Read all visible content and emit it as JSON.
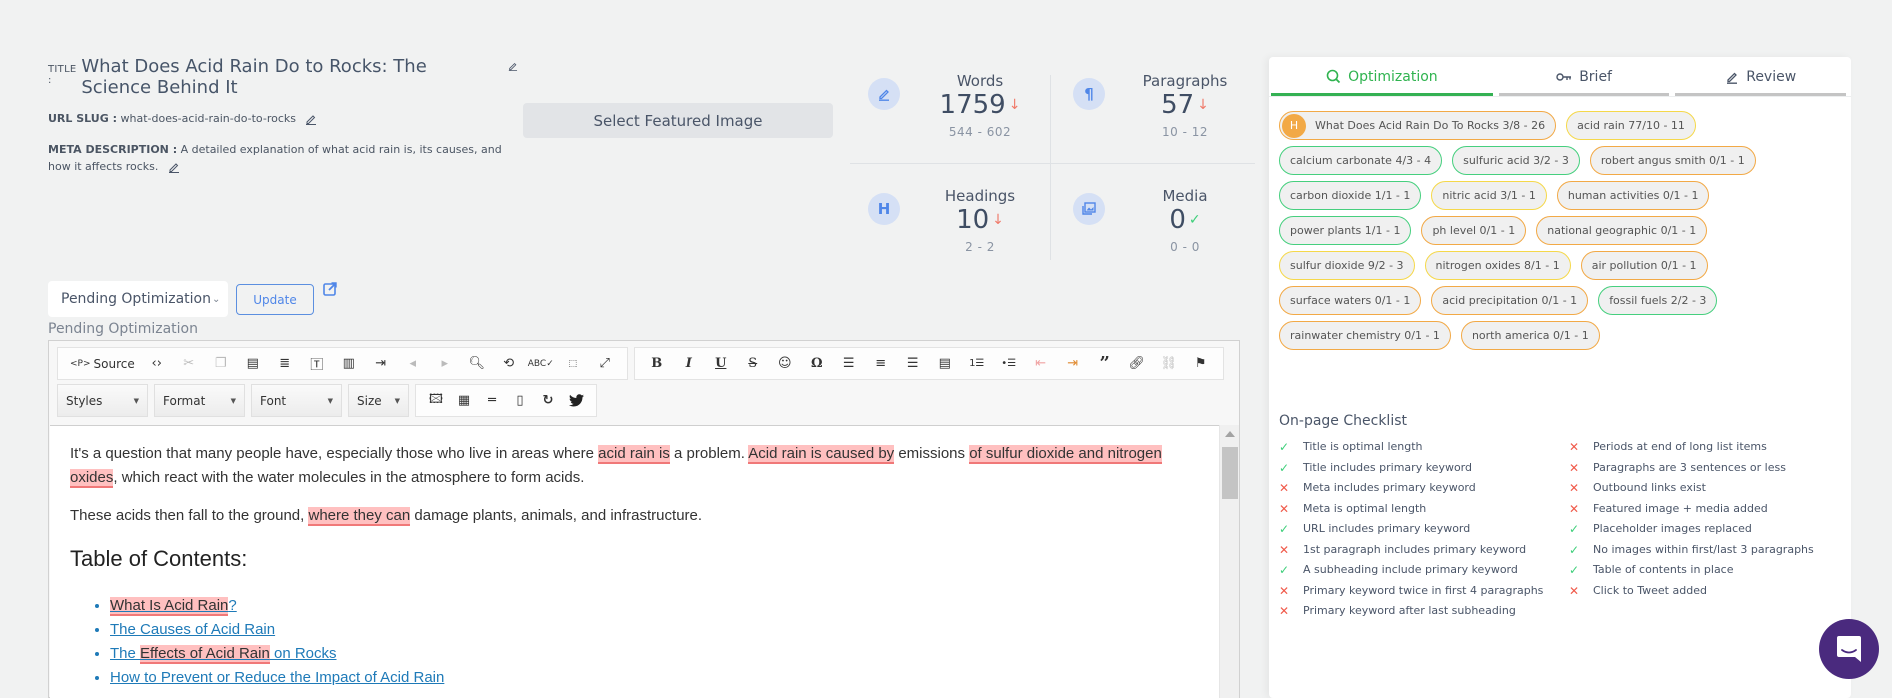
{
  "meta": {
    "title_label": "TITLE :",
    "title": "What Does Acid Rain Do to Rocks: The Science Behind It",
    "slug_label": "URL SLUG :",
    "slug": "what-does-acid-rain-do-to-rocks",
    "desc_label": "META DESCRIPTION :",
    "desc": "A detailed explanation of what acid rain is, its causes, and how it affects rocks."
  },
  "featured_button": "Select Featured Image",
  "stats": {
    "words": {
      "label": "Words",
      "value": "1759",
      "range": "544 - 602",
      "status": "down"
    },
    "paragraphs": {
      "label": "Paragraphs",
      "value": "57",
      "range": "10 - 12",
      "status": "down"
    },
    "headings": {
      "label": "Headings",
      "value": "10",
      "range": "2 - 2",
      "status": "down"
    },
    "media": {
      "label": "Media",
      "value": "0",
      "range": "0 - 0",
      "status": "ok"
    }
  },
  "status": {
    "selected": "Pending Optimization",
    "update_label": "Update",
    "current_label": "Pending Optimization"
  },
  "toolbar": {
    "source_label": "Source",
    "styles": "Styles",
    "format": "Format",
    "font": "Font",
    "size": "Size"
  },
  "content": {
    "p1": [
      "It's a question that many people have, especially those who live in areas where ",
      "acid rain is",
      " a problem. ",
      "Acid rain is caused by",
      " emissions ",
      "of sulfur dioxide and nitrogen oxides",
      ", which react with the water molecules in the atmosphere to form acids."
    ],
    "p2": [
      "These acids then fall to the ground, ",
      "where they can",
      " damage plants, animals, and infrastructure."
    ],
    "toc_heading": "Table of Contents:",
    "toc": [
      {
        "pre": "",
        "hl": "What Is Acid Rain",
        "post": "?"
      },
      {
        "pre": "The Causes of Acid Rain",
        "hl": "",
        "post": ""
      },
      {
        "pre": "The ",
        "hl": "Effects of Acid Rain",
        "post": " on Rocks"
      },
      {
        "pre": "How to Prevent or Reduce the Impact of Acid Rain",
        "hl": "",
        "post": ""
      }
    ]
  },
  "panel": {
    "tabs": [
      {
        "label": "Optimization",
        "icon": "search-icon",
        "active": true
      },
      {
        "label": "Brief",
        "icon": "key-icon",
        "active": false
      },
      {
        "label": "Review",
        "icon": "pencil-icon",
        "active": false
      }
    ],
    "keywords": [
      {
        "text": "What Does Acid Rain Do To Rocks 3/8 - 26",
        "color": "orange",
        "heading": "H"
      },
      {
        "text": "acid rain 77/10 - 11",
        "color": "yellow"
      },
      {
        "text": "calcium carbonate 4/3 - 4",
        "color": "green"
      },
      {
        "text": "sulfuric acid 3/2 - 3",
        "color": "green"
      },
      {
        "text": "robert angus smith 0/1 - 1",
        "color": "orange"
      },
      {
        "text": "carbon dioxide 1/1 - 1",
        "color": "green"
      },
      {
        "text": "nitric acid 3/1 - 1",
        "color": "yellow"
      },
      {
        "text": "human activities 0/1 - 1",
        "color": "orange"
      },
      {
        "text": "power plants 1/1 - 1",
        "color": "green"
      },
      {
        "text": "ph level 0/1 - 1",
        "color": "orange"
      },
      {
        "text": "national geographic 0/1 - 1",
        "color": "orange"
      },
      {
        "text": "sulfur dioxide 9/2 - 3",
        "color": "yellow"
      },
      {
        "text": "nitrogen oxides 8/1 - 1",
        "color": "yellow"
      },
      {
        "text": "air pollution 0/1 - 1",
        "color": "orange"
      },
      {
        "text": "surface waters 0/1 - 1",
        "color": "orange"
      },
      {
        "text": "acid precipitation 0/1 - 1",
        "color": "orange"
      },
      {
        "text": "fossil fuels 2/2 - 3",
        "color": "green"
      },
      {
        "text": "rainwater chemistry 0/1 - 1",
        "color": "orange"
      },
      {
        "text": "north america 0/1 - 1",
        "color": "orange"
      }
    ],
    "checklist_title": "On-page Checklist",
    "checklist_left": [
      {
        "text": "Title is optimal length",
        "pass": true
      },
      {
        "text": "Title includes primary keyword",
        "pass": true
      },
      {
        "text": "Meta includes primary keyword",
        "pass": false
      },
      {
        "text": "Meta is optimal length",
        "pass": false
      },
      {
        "text": "URL includes primary keyword",
        "pass": true
      },
      {
        "text": "1st paragraph includes primary keyword",
        "pass": false
      },
      {
        "text": "A subheading include primary keyword",
        "pass": true
      },
      {
        "text": "Primary keyword twice in first 4 paragraphs",
        "pass": false
      },
      {
        "text": "Primary keyword after last subheading",
        "pass": false
      }
    ],
    "checklist_right": [
      {
        "text": "Periods at end of long list items",
        "pass": false
      },
      {
        "text": "Paragraphs are 3 sentences or less",
        "pass": false
      },
      {
        "text": "Outbound links exist",
        "pass": false
      },
      {
        "text": "Featured image + media added",
        "pass": false
      },
      {
        "text": "Placeholder images replaced",
        "pass": true
      },
      {
        "text": "No images within first/last 3 paragraphs",
        "pass": true
      },
      {
        "text": "Table of contents in place",
        "pass": true
      },
      {
        "text": "Click to Tweet added",
        "pass": false
      }
    ]
  },
  "colors": {
    "accent_green": "#34b153",
    "accent_blue": "#4f86e8",
    "chip_orange": "#f2a946",
    "chip_yellow": "#f5d84a",
    "chip_green": "#46cf7e",
    "fail_red": "#f05a4a",
    "chat_purple": "#4a2a7e"
  }
}
